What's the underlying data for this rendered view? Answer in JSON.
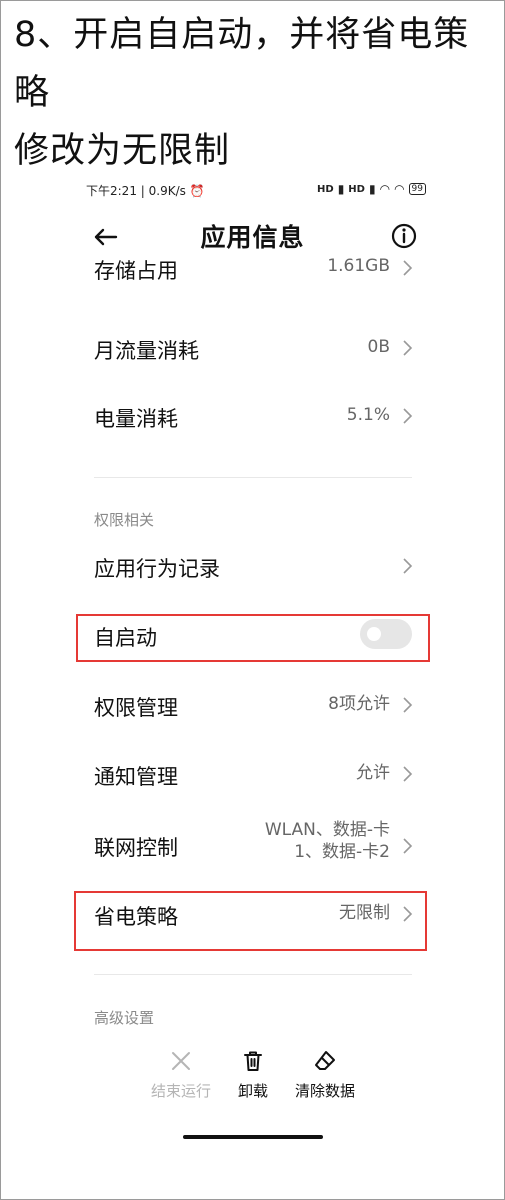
{
  "caption": {
    "line1": "8、开启自启动，并将省电策略",
    "line2": "修改为无限制"
  },
  "status_bar": {
    "left": "下午2:21 | 0.9K/s ⏰",
    "signal1": "HD",
    "signal2": "HD",
    "battery": "99"
  },
  "header": {
    "title": "应用信息",
    "back_icon": "back-arrow-icon",
    "info_icon": "info-icon"
  },
  "rows_top": [
    {
      "label": "存储占用",
      "value": "1.61GB"
    },
    {
      "label": "月流量消耗",
      "value": "0B"
    },
    {
      "label": "电量消耗",
      "value": "5.1%"
    }
  ],
  "permissions": {
    "section": "权限相关",
    "behavior_log": "应用行为记录",
    "autostart": {
      "label": "自启动",
      "enabled": false
    },
    "permission_mgmt": {
      "label": "权限管理",
      "value": "8项允许"
    },
    "notification_mgmt": {
      "label": "通知管理",
      "value": "允许"
    },
    "network": {
      "label": "联网控制",
      "value_line1": "WLAN、数据-卡",
      "value_line2": "1、数据-卡2"
    },
    "battery_saver": {
      "label": "省电策略",
      "value": "无限制"
    }
  },
  "advanced": {
    "section": "高级设置"
  },
  "bottom_bar": {
    "stop": "结束运行",
    "uninstall": "卸载",
    "clear": "清除数据"
  },
  "colors": {
    "highlight": "#e53935",
    "toggle_off": "#e6e6e6"
  }
}
